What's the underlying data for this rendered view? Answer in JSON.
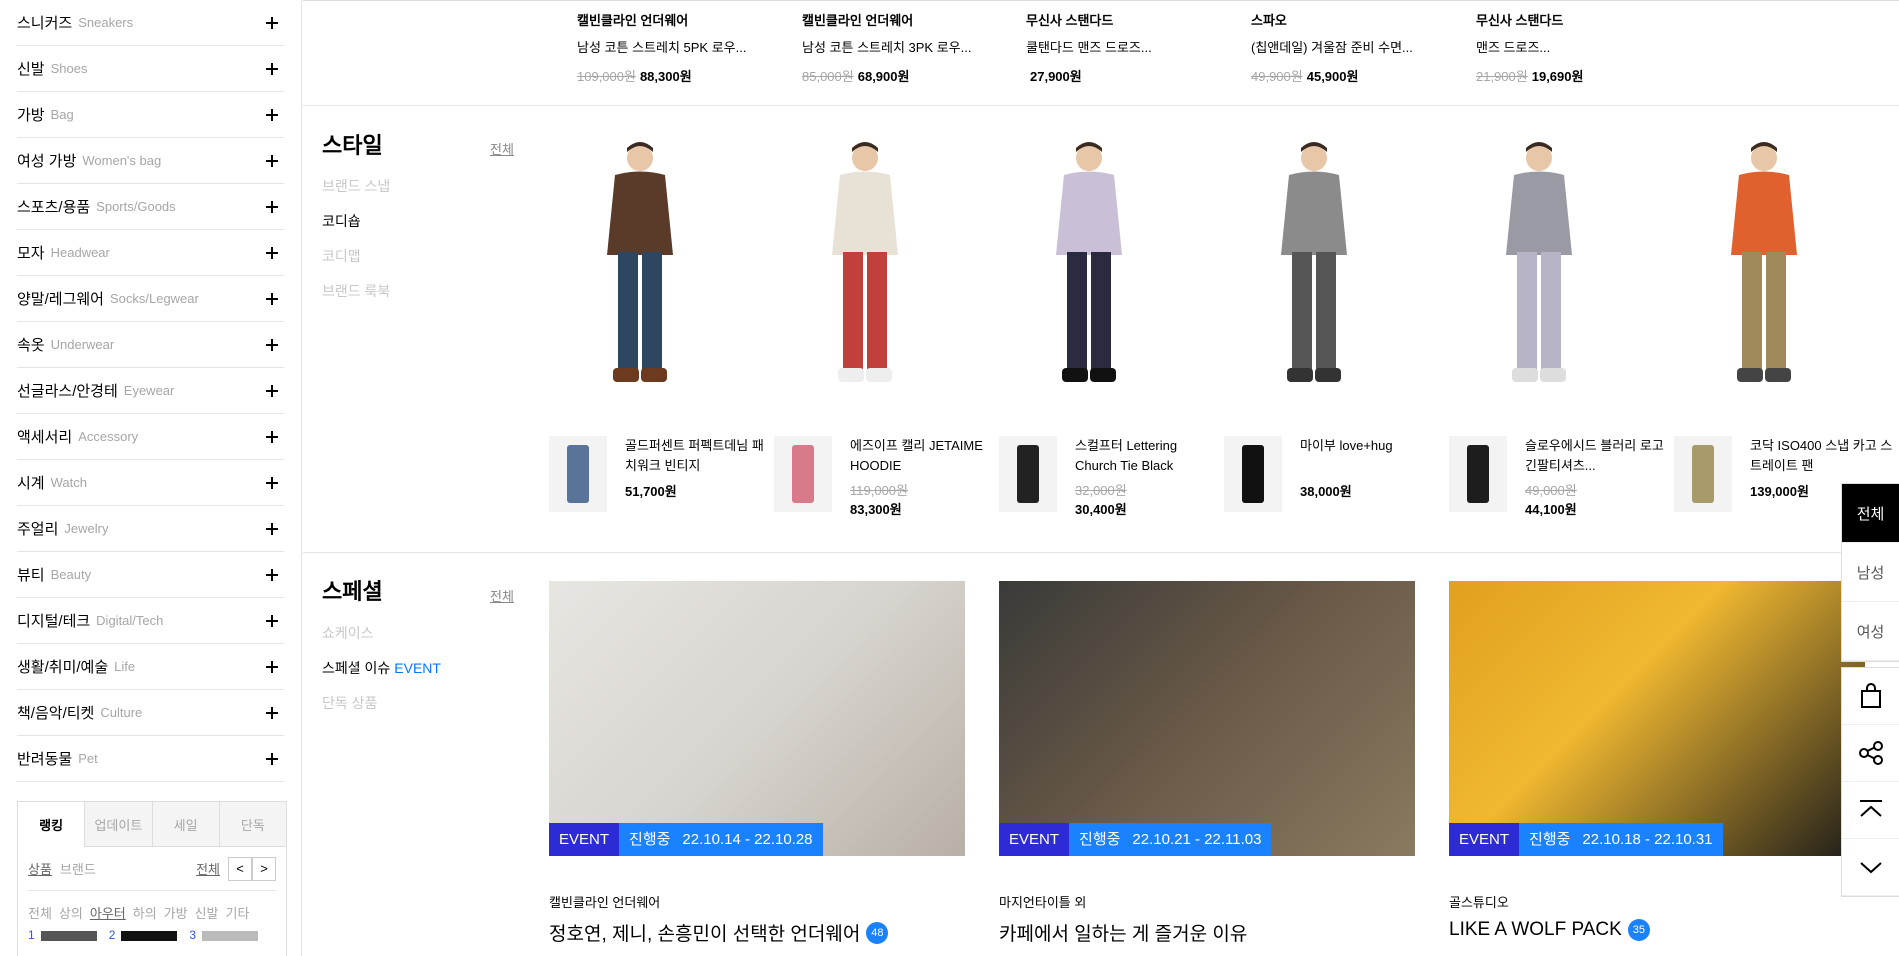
{
  "sidebar": {
    "categories": [
      {
        "ko": "스니커즈",
        "en": "Sneakers"
      },
      {
        "ko": "신발",
        "en": "Shoes"
      },
      {
        "ko": "가방",
        "en": "Bag"
      },
      {
        "ko": "여성 가방",
        "en": "Women's bag"
      },
      {
        "ko": "스포츠/용품",
        "en": "Sports/Goods"
      },
      {
        "ko": "모자",
        "en": "Headwear"
      },
      {
        "ko": "양말/레그웨어",
        "en": "Socks/Legwear"
      },
      {
        "ko": "속옷",
        "en": "Underwear"
      },
      {
        "ko": "선글라스/안경테",
        "en": "Eyewear"
      },
      {
        "ko": "액세서리",
        "en": "Accessory"
      },
      {
        "ko": "시계",
        "en": "Watch"
      },
      {
        "ko": "주얼리",
        "en": "Jewelry"
      },
      {
        "ko": "뷰티",
        "en": "Beauty"
      },
      {
        "ko": "디지털/테크",
        "en": "Digital/Tech"
      },
      {
        "ko": "생활/취미/예술",
        "en": "Life"
      },
      {
        "ko": "책/음악/티켓",
        "en": "Culture"
      },
      {
        "ko": "반려동물",
        "en": "Pet"
      }
    ],
    "rank_tabs": [
      "랭킹",
      "업데이트",
      "세일",
      "단독"
    ],
    "rank_sub": {
      "product": "상품",
      "brand": "브랜드",
      "all": "전체",
      "prev": "<",
      "next": ">"
    },
    "rank_filters": [
      "전체",
      "상의",
      "아우터",
      "하의",
      "가방",
      "신발",
      "기타"
    ],
    "rank_nums": [
      "1",
      "2",
      "3"
    ]
  },
  "top_products": [
    {
      "brand": "캘빈클라인 언더웨어",
      "name": "남성 코튼 스트레치 5PK 로우...",
      "orig": "109,000원",
      "price": "88,300원"
    },
    {
      "brand": "캘빈클라인 언더웨어",
      "name": "남성 코튼 스트레치 3PK 로우...",
      "orig": "85,000원",
      "price": "68,900원"
    },
    {
      "brand": "무신사 스탠다드",
      "name": "쿨탠다드 맨즈 드로즈...",
      "orig": "",
      "price": "27,900원"
    },
    {
      "brand": "스파오",
      "name": "(칩앤데일) 겨울잠 준비 수면...",
      "orig": "49,900원",
      "price": "45,900원"
    },
    {
      "brand": "무신사 스탠다드",
      "name": "맨즈 드로즈...",
      "orig": "21,900원",
      "price": "19,690원"
    }
  ],
  "style": {
    "title": "스타일",
    "all": "전체",
    "menu": [
      "브랜드 스냅",
      "코디숍",
      "코디맵",
      "브랜드 룩북"
    ],
    "products": [
      {
        "name": "골드퍼센트 퍼펙트데님 패치워크 빈티지",
        "orig": "",
        "price": "51,700원"
      },
      {
        "name": "에즈이프 캘리 JETAIME HOODIE",
        "orig": "119,000원",
        "price": "83,300원"
      },
      {
        "name": "스컬프터 Lettering Church Tie Black",
        "orig": "32,000원",
        "price": "30,400원"
      },
      {
        "name": "마이부 love+hug",
        "orig": "",
        "price": "38,000원"
      },
      {
        "name": "슬로우에시드 블러리 로고 긴팔티셔츠...",
        "orig": "49,000원",
        "price": "44,100원"
      },
      {
        "name": "코닥 ISO400 스냅 카고 스트레이트 팬",
        "orig": "",
        "price": "139,000원"
      }
    ]
  },
  "special": {
    "title": "스페셜",
    "all": "전체",
    "menu": [
      {
        "label": "쇼케이스",
        "tag": ""
      },
      {
        "label": "스페셜 이슈",
        "tag": "EVENT"
      },
      {
        "label": "단독 상품",
        "tag": ""
      }
    ],
    "cards": [
      {
        "event": "EVENT",
        "status": "진행중",
        "dates": "22.10.14 - 22.10.28",
        "category": "캘빈클라인 언더웨어",
        "title": "정호연, 제니, 손흥민이 선택한 언더웨어",
        "count": "48"
      },
      {
        "event": "EVENT",
        "status": "진행중",
        "dates": "22.10.21 - 22.11.03",
        "category": "마지언타이틀 외",
        "title": "카페에서 일하는 게 즐거운 이유",
        "count": ""
      },
      {
        "event": "EVENT",
        "status": "진행중",
        "dates": "22.10.18 - 22.10.31",
        "category": "골스튜디오",
        "title": "LIKE A WOLF PACK",
        "count": "35"
      }
    ]
  },
  "floating": {
    "gender": [
      "전체",
      "남성",
      "여성"
    ],
    "actions": [
      "cart-icon",
      "share-icon",
      "scroll-top-icon",
      "scroll-down-icon"
    ]
  }
}
